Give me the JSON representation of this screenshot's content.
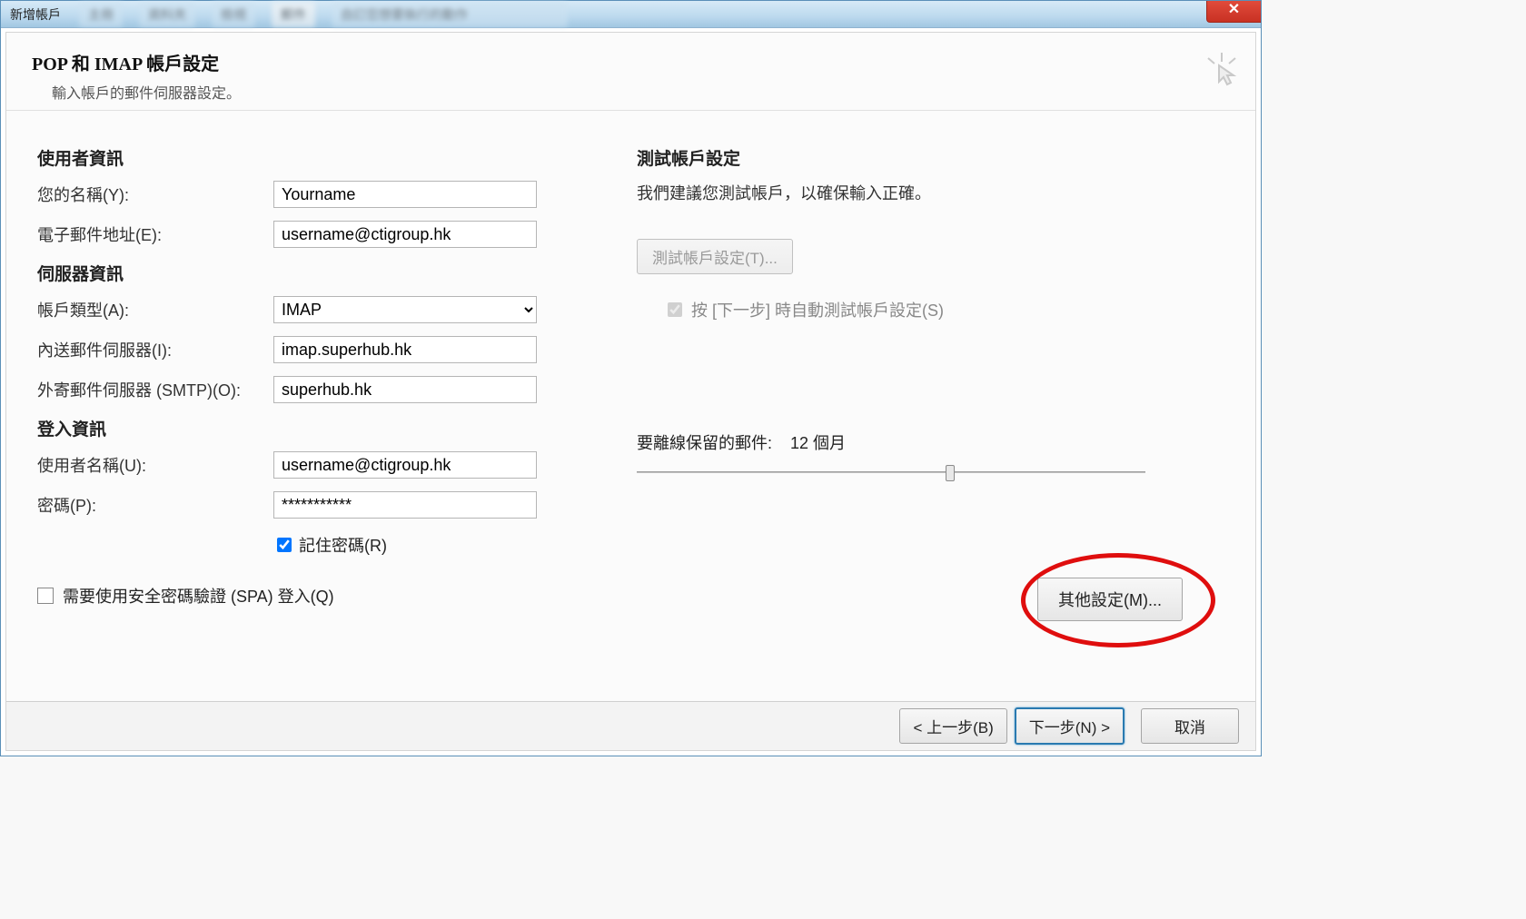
{
  "window": {
    "title": "新增帳戶",
    "close_symbol": "✕"
  },
  "header": {
    "title": "POP 和 IMAP 帳戶設定",
    "subtitle": "輸入帳戶的郵件伺服器設定。"
  },
  "user_info": {
    "section": "使用者資訊",
    "name_label": "您的名稱(Y):",
    "name_value": "Yourname",
    "email_label": "電子郵件地址(E):",
    "email_value": "username@ctigroup.hk"
  },
  "server_info": {
    "section": "伺服器資訊",
    "type_label": "帳戶類型(A):",
    "type_value": "IMAP",
    "incoming_label": "內送郵件伺服器(I):",
    "incoming_value": "imap.superhub.hk",
    "outgoing_label": "外寄郵件伺服器 (SMTP)(O):",
    "outgoing_value": "superhub.hk"
  },
  "login_info": {
    "section": "登入資訊",
    "user_label": "使用者名稱(U):",
    "user_value": "username@ctigroup.hk",
    "pass_label": "密碼(P):",
    "pass_value": "***********",
    "remember_label": "記住密碼(R)"
  },
  "spa_label": "需要使用安全密碼驗證 (SPA) 登入(Q)",
  "test": {
    "section": "測試帳戶設定",
    "desc": "我們建議您測試帳戶，以確保輸入正確。",
    "button": "測試帳戶設定(T)...",
    "auto_label": "按 [下一步] 時自動測試帳戶設定(S)"
  },
  "offline": {
    "label": "要離線保留的郵件:",
    "value": "12 個月"
  },
  "more_settings": "其他設定(M)...",
  "footer": {
    "back": "< 上一步(B)",
    "next": "下一步(N) >",
    "cancel": "取消"
  }
}
